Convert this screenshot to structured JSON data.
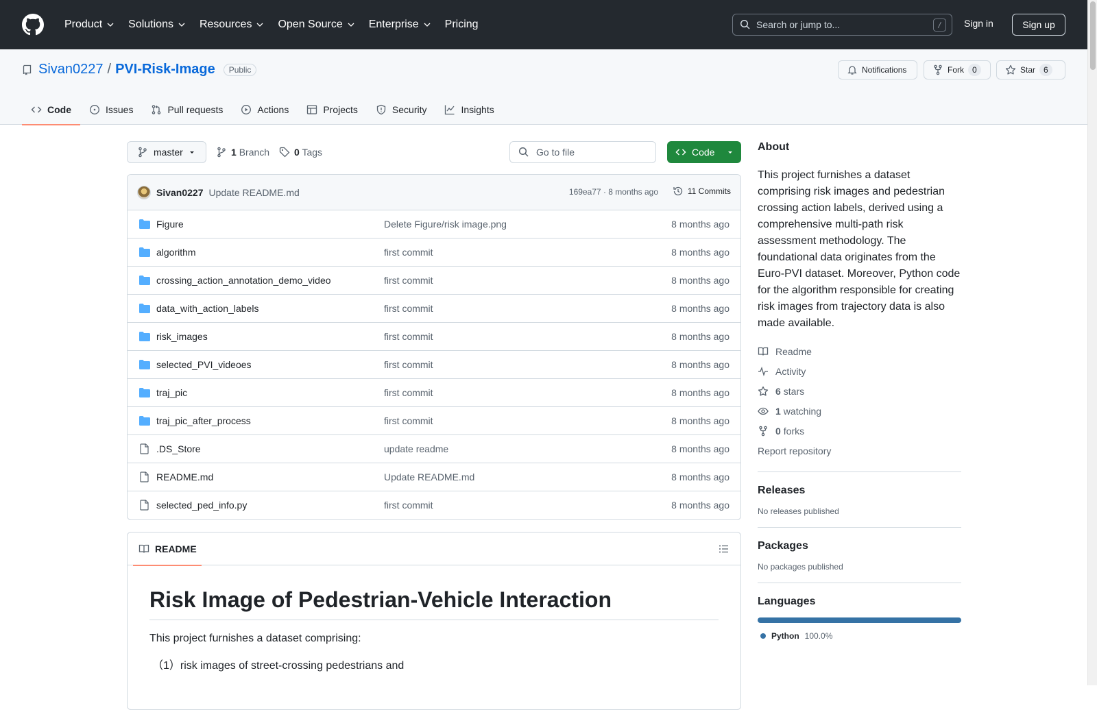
{
  "nav": {
    "items": [
      {
        "label": "Product",
        "has_menu": true
      },
      {
        "label": "Solutions",
        "has_menu": true
      },
      {
        "label": "Resources",
        "has_menu": true
      },
      {
        "label": "Open Source",
        "has_menu": true
      },
      {
        "label": "Enterprise",
        "has_menu": true
      },
      {
        "label": "Pricing",
        "has_menu": false
      }
    ],
    "search_placeholder": "Search or jump to...",
    "search_key": "/",
    "sign_in": "Sign in",
    "sign_up": "Sign up"
  },
  "repo": {
    "owner": "Sivan0227",
    "separator": "/",
    "name": "PVI-Risk-Image",
    "visibility": "Public",
    "notifications_label": "Notifications",
    "fork_label": "Fork",
    "fork_count": "0",
    "star_label": "Star",
    "star_count": "6"
  },
  "tabs": [
    {
      "label": "Code",
      "icon": "code-icon",
      "active": true
    },
    {
      "label": "Issues",
      "icon": "issue-opened-icon",
      "active": false
    },
    {
      "label": "Pull requests",
      "icon": "git-pull-request-icon",
      "active": false
    },
    {
      "label": "Actions",
      "icon": "play-icon",
      "active": false
    },
    {
      "label": "Projects",
      "icon": "table-icon",
      "active": false
    },
    {
      "label": "Security",
      "icon": "shield-icon",
      "active": false
    },
    {
      "label": "Insights",
      "icon": "graph-icon",
      "active": false
    }
  ],
  "branch": {
    "name": "master",
    "branch_count": "1",
    "branch_label": "Branch",
    "tag_count": "0",
    "tag_label": "Tags",
    "goto_placeholder": "Go to file",
    "code_label": "Code"
  },
  "commit": {
    "author": "Sivan0227",
    "message": "Update README.md",
    "meta": "169ea77 · 8 months ago",
    "commits_label": "11 Commits"
  },
  "files": [
    {
      "type": "dir",
      "name": "Figure",
      "message": "Delete Figure/risk image.png",
      "time": "8 months ago"
    },
    {
      "type": "dir",
      "name": "algorithm",
      "message": "first commit",
      "time": "8 months ago"
    },
    {
      "type": "dir",
      "name": "crossing_action_annotation_demo_video",
      "message": "first commit",
      "time": "8 months ago"
    },
    {
      "type": "dir",
      "name": "data_with_action_labels",
      "message": "first commit",
      "time": "8 months ago"
    },
    {
      "type": "dir",
      "name": "risk_images",
      "message": "first commit",
      "time": "8 months ago"
    },
    {
      "type": "dir",
      "name": "selected_PVI_videoes",
      "message": "first commit",
      "time": "8 months ago"
    },
    {
      "type": "dir",
      "name": "traj_pic",
      "message": "first commit",
      "time": "8 months ago"
    },
    {
      "type": "dir",
      "name": "traj_pic_after_process",
      "message": "first commit",
      "time": "8 months ago"
    },
    {
      "type": "file",
      "name": ".DS_Store",
      "message": "update readme",
      "time": "8 months ago"
    },
    {
      "type": "file",
      "name": "README.md",
      "message": "Update README.md",
      "time": "8 months ago"
    },
    {
      "type": "file",
      "name": "selected_ped_info.py",
      "message": "first commit",
      "time": "8 months ago"
    }
  ],
  "readme": {
    "tab_label": "README",
    "heading": "Risk Image of Pedestrian-Vehicle Interaction",
    "para1": "This project furnishes a dataset comprising:",
    "item1": "（1）risk images of street-crossing pedestrians and"
  },
  "about": {
    "heading": "About",
    "description": "This project furnishes a dataset comprising risk images and pedestrian crossing action labels, derived using a comprehensive multi-path risk assessment methodology. The foundational data originates from the Euro-PVI dataset. Moreover, Python code for the algorithm responsible for creating risk images from trajectory data is also made available.",
    "readme_label": "Readme",
    "activity_label": "Activity",
    "stars_count": "6",
    "stars_label": "stars",
    "watching_count": "1",
    "watching_label": "watching",
    "forks_count": "0",
    "forks_label": "forks",
    "report_label": "Report repository"
  },
  "releases": {
    "heading": "Releases",
    "text": "No releases published"
  },
  "packages": {
    "heading": "Packages",
    "text": "No packages published"
  },
  "languages": {
    "heading": "Languages",
    "items": [
      {
        "name": "Python",
        "percent": "100.0%",
        "color": "#3572a5",
        "share": 100
      }
    ]
  },
  "colors": {
    "header_bg": "#24292f",
    "accent_link": "#0969da",
    "code_button": "#1f883d",
    "tab_underline": "#fd8c73",
    "folder": "#54aeff"
  }
}
